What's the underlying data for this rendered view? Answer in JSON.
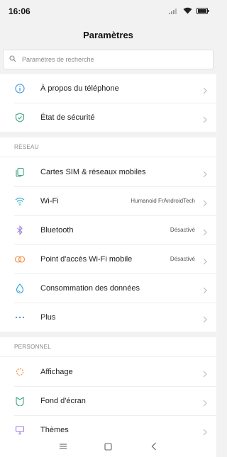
{
  "status_bar": {
    "time": "16:06",
    "icons": [
      "signal-icon",
      "wifi-icon",
      "battery-icon"
    ]
  },
  "header": {
    "title": "Paramètres"
  },
  "search": {
    "placeholder": "Paramètres de recherche"
  },
  "groups": {
    "top": [
      {
        "label": "À propos du téléphone",
        "icon": "info-icon"
      },
      {
        "label": "État de sécurité",
        "icon": "shield-icon"
      }
    ],
    "network": {
      "header": "RÉSEAU",
      "items": [
        {
          "label": "Cartes SIM & réseaux mobiles",
          "icon": "sim-card-icon"
        },
        {
          "label": "Wi-Fi",
          "value": "Humanoid FrAndroidTech",
          "icon": "wifi-icon"
        },
        {
          "label": "Bluetooth",
          "value": "Désactivé",
          "icon": "bluetooth-icon"
        },
        {
          "label": "Point d'accès Wi-Fi mobile",
          "value": "Désactivé",
          "icon": "hotspot-icon"
        },
        {
          "label": "Consommation des données",
          "icon": "data-usage-icon"
        },
        {
          "label": "Plus",
          "icon": "more-icon"
        }
      ]
    },
    "personal": {
      "header": "PERSONNEL",
      "items": [
        {
          "label": "Affichage",
          "icon": "display-icon"
        },
        {
          "label": "Fond d'écran",
          "icon": "wallpaper-icon"
        },
        {
          "label": "Thèmes",
          "icon": "themes-icon"
        }
      ]
    }
  },
  "nav_bar": [
    "menu-icon",
    "home-icon",
    "back-icon"
  ],
  "colors": {
    "info": "#3b8fd8",
    "security": "#3aa57a",
    "sim": "#3aa57a",
    "wifi": "#2ba9cf",
    "bluetooth": "#9b7be0",
    "hotspot": "#f08a3c",
    "data": "#2aa3d9",
    "more": "#3b8fd8",
    "display": "#f08a3c",
    "wallpaper": "#3aa57a",
    "themes": "#9b7be0"
  }
}
